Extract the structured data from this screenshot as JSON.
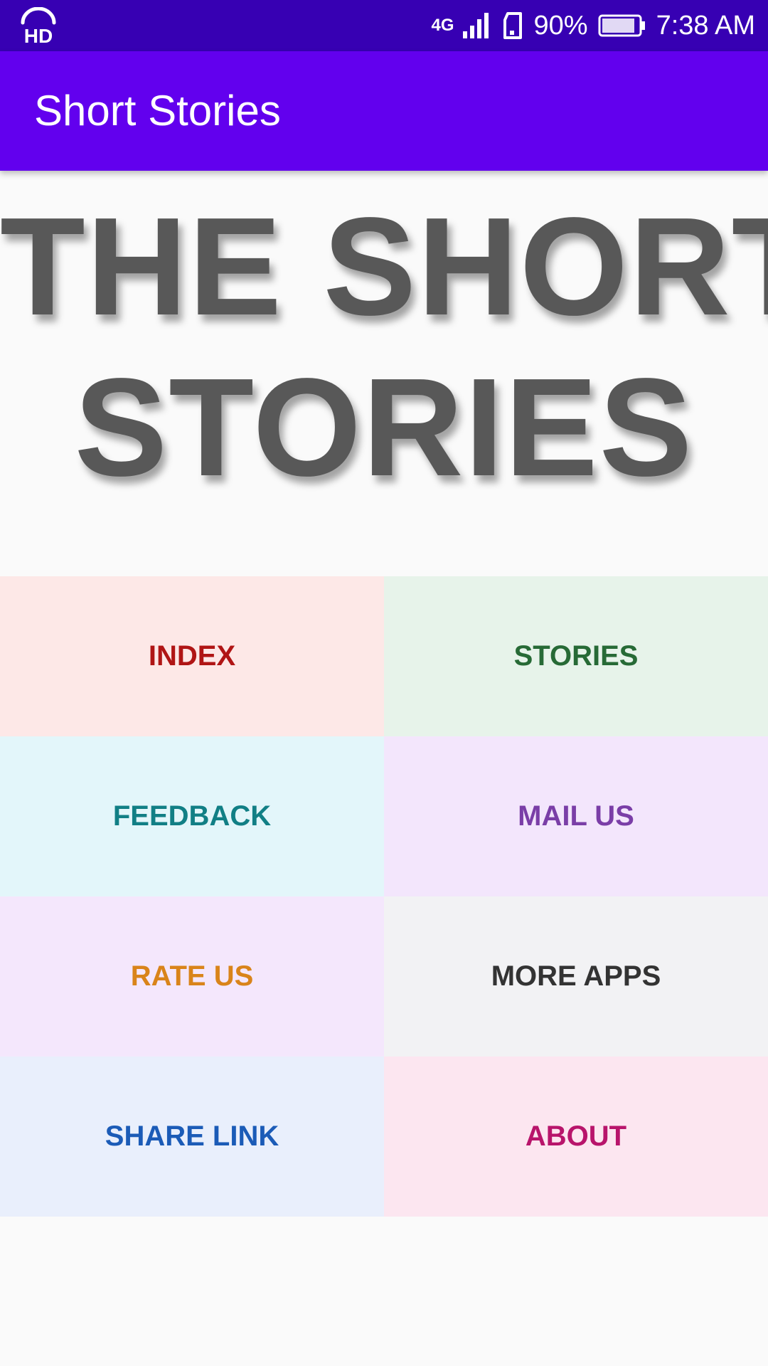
{
  "status_bar": {
    "hd_label": "HD",
    "network_type": "4G",
    "battery_percent": "90%",
    "time": "7:38 AM",
    "battery_level": 0.9,
    "icons": [
      "hd-audio-icon",
      "signal-icon",
      "sim-icon",
      "battery-icon"
    ]
  },
  "app_bar": {
    "title": "Short Stories",
    "color": "#6200ee",
    "status_color": "#3700b3"
  },
  "hero": {
    "line1": "THE SHORT",
    "line2": "STORIES"
  },
  "menu": {
    "index": {
      "label": "INDEX",
      "color": "#b01515",
      "bg": "#fde8e7"
    },
    "stories": {
      "label": "STORIES",
      "color": "#276a36",
      "bg": "#e7f3ea"
    },
    "feedback": {
      "label": "FEEDBACK",
      "color": "#117f85",
      "bg": "#e3f6fa"
    },
    "mail_us": {
      "label": "MAIL US",
      "color": "#7a3ea7",
      "bg": "#f3e6fc"
    },
    "rate_us": {
      "label": "RATE US",
      "color": "#d9841a",
      "bg": "#f4e7fc"
    },
    "more_apps": {
      "label": "MORE APPS",
      "color": "#333333",
      "bg": "#f2f2f4"
    },
    "share_link": {
      "label": "SHARE LINK",
      "color": "#1b5bb7",
      "bg": "#e9effc"
    },
    "about": {
      "label": "ABOUT",
      "color": "#b8146b",
      "bg": "#fce6f0"
    }
  }
}
